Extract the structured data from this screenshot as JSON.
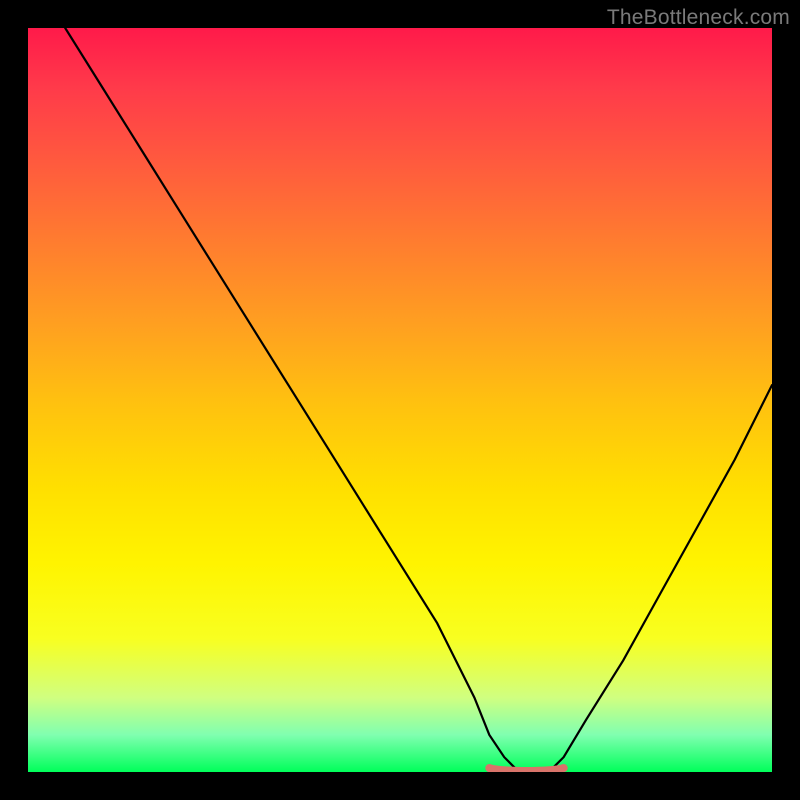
{
  "watermark": "TheBottleneck.com",
  "chart_data": {
    "type": "line",
    "title": "",
    "xlabel": "",
    "ylabel": "",
    "xlim": [
      0,
      100
    ],
    "ylim": [
      0,
      100
    ],
    "series": [
      {
        "name": "curve",
        "x": [
          5,
          10,
          15,
          20,
          25,
          30,
          35,
          40,
          45,
          50,
          55,
          60,
          62,
          64,
          66,
          68,
          70,
          72,
          75,
          80,
          85,
          90,
          95,
          100
        ],
        "values": [
          100,
          92,
          84,
          76,
          68,
          60,
          52,
          44,
          36,
          28,
          20,
          10,
          5,
          2,
          0,
          0,
          0,
          2,
          7,
          15,
          24,
          33,
          42,
          52
        ]
      }
    ],
    "highlight": {
      "name": "bottom-segment",
      "x": [
        62,
        72
      ],
      "y": 0,
      "color": "#d9746a",
      "thickness": 8
    },
    "gradient_background": {
      "top": "#ff1a4a",
      "bottom": "#00ff5a"
    }
  }
}
